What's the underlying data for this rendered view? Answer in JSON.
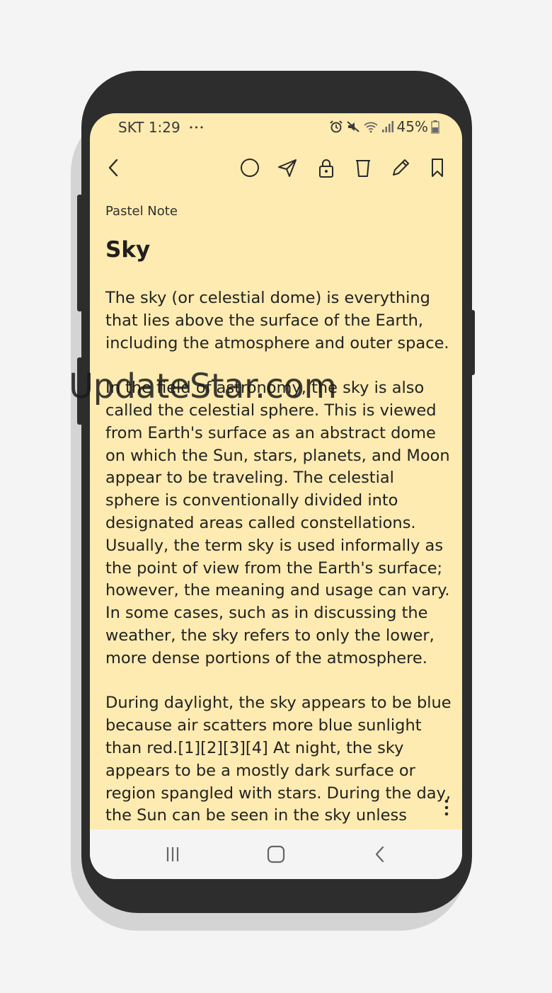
{
  "status_bar": {
    "carrier_time": "SKT 1:29",
    "more": "•••",
    "battery_percent": "45%",
    "icons": [
      "alarm-icon",
      "mute-icon",
      "wifi-icon",
      "signal-icon",
      "battery-icon"
    ]
  },
  "toolbar": {
    "icons": [
      "back-arrow-icon",
      "circle-icon",
      "share-icon",
      "lock-icon",
      "trash-icon",
      "edit-icon",
      "bookmark-icon"
    ]
  },
  "note": {
    "category": "Pastel Note",
    "title": "Sky",
    "paragraphs": [
      "The sky (or celestial dome) is everything that lies above the surface of the Earth, including the atmosphere and outer space.",
      "In the field of astronomy, the sky is also called the celestial sphere. This is viewed from Earth's surface as an abstract dome on which the Sun, stars, planets, and Moon appear to be traveling. The celestial sphere is conventionally divided into designated areas called constellations. Usually, the term sky is used informally as the point of view from the Earth's surface; however, the meaning and usage can vary. In some cases, such as in discussing the weather, the sky refers to only the lower, more dense portions of the atmosphere.",
      "During daylight, the sky appears to be blue because air scatters more blue sunlight than red.[1][2][3][4] At night, the sky appears to be a mostly dark surface or region spangled with stars. During the day, the Sun can be seen in the sky unless"
    ]
  },
  "watermark": "UpdateStar.com",
  "navbar": {
    "icons": [
      "recent-apps-icon",
      "home-icon",
      "back-icon"
    ]
  },
  "colors": {
    "note_background": "#fdebb1",
    "phone_frame": "#2d2d2d",
    "navbar_background": "#f4f4f4"
  }
}
